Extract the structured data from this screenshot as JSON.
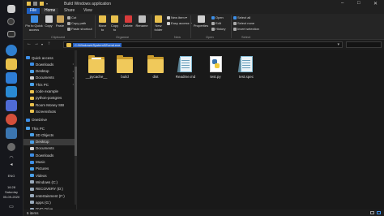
{
  "window": {
    "title": "Build Windows application",
    "minimize_glyph": "–",
    "maximize_glyph": "□",
    "close_glyph": "✕"
  },
  "tabs": [
    "File",
    "Home",
    "Share",
    "View"
  ],
  "ribbon": {
    "clipboard": {
      "pin": "Pin to Quick access",
      "copy": "Copy",
      "paste": "Paste",
      "cut": "Cut",
      "copy_path": "Copy path",
      "paste_shortcut": "Paste shortcut",
      "group": "Clipboard"
    },
    "organize": {
      "move_to": "Move to",
      "copy_to": "Copy to",
      "delete": "Delete",
      "rename": "Rename",
      "group": "Organize"
    },
    "new": {
      "new_folder": "New folder",
      "new_item": "New item",
      "easy_access": "Easy access",
      "group": "New"
    },
    "open": {
      "properties": "Properties",
      "open": "Open",
      "edit": "Edit",
      "history": "History",
      "group": "Open"
    },
    "select": {
      "select_all": "Select all",
      "select_none": "Select none",
      "invert_selection": "Invert selection",
      "group": "Select"
    }
  },
  "address": {
    "path": "C:\\Windows\\System32\\cmd.exe"
  },
  "nav": {
    "items": [
      {
        "label": "Quick access",
        "icon": "star-icon",
        "color": "#3d8ee6"
      },
      {
        "label": "Downloads",
        "icon": "download-icon",
        "color": "#3d8ee6"
      },
      {
        "label": "Desktop",
        "icon": "desktop-icon",
        "color": "#4aa0e8"
      },
      {
        "label": "Documents",
        "icon": "documents-icon",
        "color": "#cfcfcf"
      },
      {
        "label": "This PC",
        "icon": "pc-icon",
        "color": "#4aa0e8"
      },
      {
        "label": "code example",
        "icon": "folder-icon",
        "color": "#e8c04c"
      },
      {
        "label": "python-postgres",
        "icon": "folder-icon",
        "color": "#e8c04c"
      },
      {
        "label": "Room Money SBI",
        "icon": "folder-icon",
        "color": "#e8c04c"
      },
      {
        "label": "Screenshots",
        "icon": "folder-icon",
        "color": "#e8c04c"
      },
      {
        "label": "OneDrive",
        "icon": "cloud-icon",
        "color": "#3d8ee6"
      },
      {
        "label": "This PC",
        "icon": "pc-icon",
        "color": "#4aa0e8"
      },
      {
        "label": "3D Objects",
        "icon": "cube-icon",
        "color": "#4aa0e8"
      },
      {
        "label": "Desktop",
        "icon": "desktop-icon",
        "color": "#4aa0e8"
      },
      {
        "label": "Documents",
        "icon": "documents-icon",
        "color": "#cfcfcf"
      },
      {
        "label": "Downloads",
        "icon": "download-icon",
        "color": "#3d8ee6"
      },
      {
        "label": "Music",
        "icon": "music-icon",
        "color": "#3d8ee6"
      },
      {
        "label": "Pictures",
        "icon": "pictures-icon",
        "color": "#4aa0e8"
      },
      {
        "label": "Videos",
        "icon": "videos-icon",
        "color": "#4aa0e8"
      },
      {
        "label": "Windows (C:)",
        "icon": "drive-icon",
        "color": "#9ab"
      },
      {
        "label": "RECOVERY (D:)",
        "icon": "drive-icon",
        "color": "#9ab"
      },
      {
        "label": "entertainment (F:)",
        "icon": "drive-icon",
        "color": "#9ab"
      },
      {
        "label": "apps (G:)",
        "icon": "drive-icon",
        "color": "#9ab"
      },
      {
        "label": "DVD Drive",
        "icon": "dvd-icon",
        "color": "#9ab"
      }
    ]
  },
  "files": [
    {
      "name": "__pycache__",
      "type": "folder"
    },
    {
      "name": "build",
      "type": "folder"
    },
    {
      "name": "dist",
      "type": "folder"
    },
    {
      "name": "Readme.md",
      "type": "notepad"
    },
    {
      "name": "test.py",
      "type": "python"
    },
    {
      "name": "test.spec",
      "type": "notepad"
    }
  ],
  "status": {
    "count": "6 items"
  },
  "taskbar": {
    "time": "16:28",
    "day": "Saturday",
    "date": "05-09-2020",
    "lang": "ENG"
  }
}
